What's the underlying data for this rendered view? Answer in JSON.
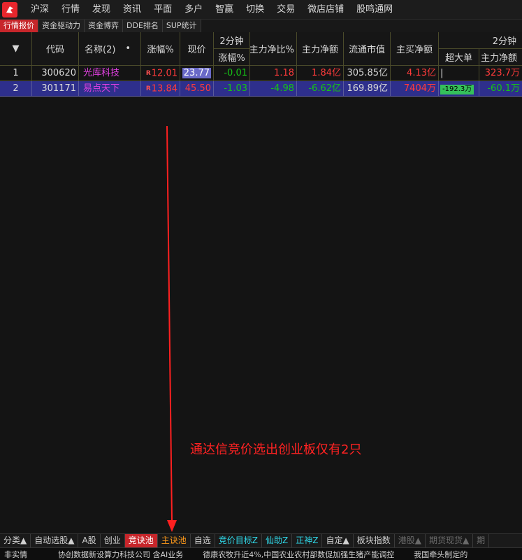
{
  "menu": [
    "沪深",
    "行情",
    "发现",
    "资讯",
    "平面",
    "多户",
    "智赢",
    "切换",
    "交易",
    "微店店铺",
    "股鸣通网"
  ],
  "tabs": [
    {
      "label": "行情报价",
      "active": true
    },
    {
      "label": "资金驱动力",
      "active": false
    },
    {
      "label": "资金博弈",
      "active": false
    },
    {
      "label": "DDE排名",
      "active": false
    },
    {
      "label": "SUP统计",
      "active": false
    }
  ],
  "table": {
    "headers": {
      "sort": "▼",
      "code": "代码",
      "name": "名称(2)",
      "name_dot": "•",
      "change_pct": "涨幅%",
      "price": "现价",
      "two_min_top": "2分钟",
      "two_min_bottom": "涨幅%",
      "main_net_ratio": "主力净比%",
      "main_net": "主力净额",
      "float_cap": "流通市值",
      "main_buy_net": "主买净额",
      "two_min_group": "2分钟",
      "super_large": "超大单",
      "main_net_2": "主力净额"
    },
    "rows": [
      {
        "idx": "1",
        "code": "300620",
        "name": "光库科技",
        "mark": "R",
        "change_pct": "12.01",
        "price": "23.77",
        "two_min": "-0.01",
        "main_net_ratio": "1.18",
        "main_net": "1.84亿",
        "float_cap": "305.85亿",
        "main_buy_net": "4.13亿",
        "super_large": "|",
        "main_net_2": "323.7万"
      },
      {
        "idx": "2",
        "code": "301171",
        "name": "易点天下",
        "mark": "R",
        "change_pct": "13.84",
        "price": "45.50",
        "two_min": "-1.03",
        "main_net_ratio": "-4.98",
        "main_net": "-6.62亿",
        "float_cap": "169.89亿",
        "main_buy_net": "7404万",
        "super_large": "-192.3万",
        "main_net_2": "-60.1万"
      }
    ]
  },
  "annotation": "通达信竞价选出创业板仅有2只",
  "bottom_tabs": [
    {
      "label": "分类▲",
      "style": ""
    },
    {
      "label": "自动选股▲",
      "style": ""
    },
    {
      "label": "A股",
      "style": ""
    },
    {
      "label": "创业",
      "style": ""
    },
    {
      "label": "竞诀池",
      "style": "active"
    },
    {
      "label": "主诀池",
      "style": "orange"
    },
    {
      "label": "自选",
      "style": ""
    },
    {
      "label": "竞价目标Z",
      "style": "cyan"
    },
    {
      "label": "仙助Z",
      "style": "cyan"
    },
    {
      "label": "正神Z",
      "style": "cyan"
    },
    {
      "label": "自定▲",
      "style": ""
    },
    {
      "label": "板块指数",
      "style": ""
    },
    {
      "label": "港股▲",
      "style": "dim"
    },
    {
      "label": "期货现货▲",
      "style": "dim"
    },
    {
      "label": "期",
      "style": "dim"
    }
  ],
  "ticker": {
    "label": "非实情",
    "items": [
      "协创数据新设算力科技公司 含AI业务",
      "德康农牧升近4%,中国农业农村部数促加强生猪产能调控",
      "我国牵头制定的"
    ]
  },
  "colors": {
    "up": "#ff3b3b",
    "down": "#16c316",
    "accent": "#c7262b",
    "selected_row": "#2e2f8c"
  }
}
